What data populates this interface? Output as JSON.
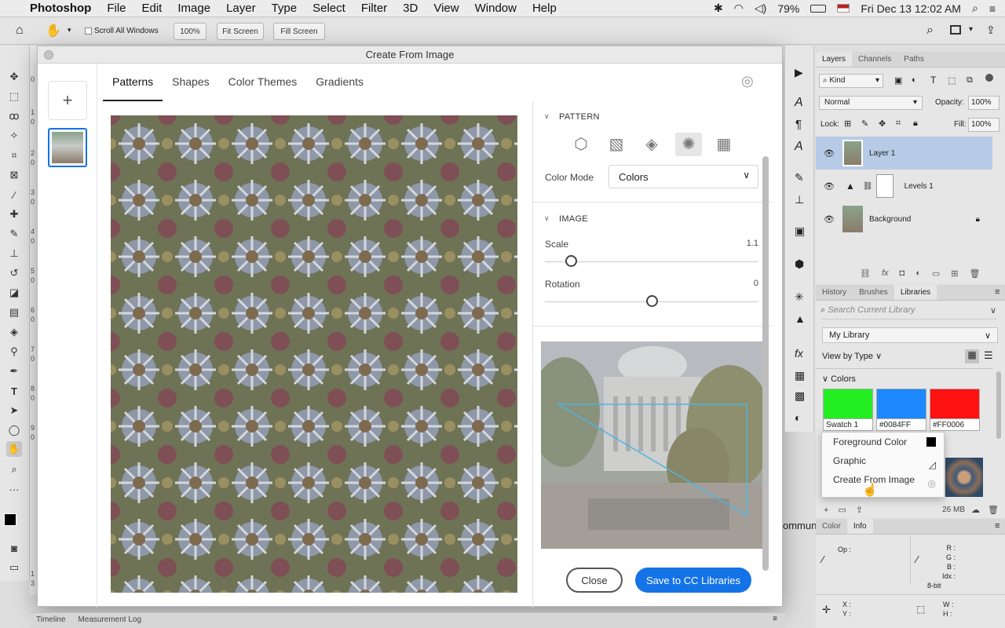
{
  "menubar": {
    "app": "Photoshop",
    "items": [
      "File",
      "Edit",
      "Image",
      "Layer",
      "Type",
      "Select",
      "Filter",
      "3D",
      "View",
      "Window",
      "Help"
    ],
    "battery": "79%",
    "datetime": "Fri Dec 13  12:02 AM"
  },
  "options": {
    "scroll_all": "Scroll All Windows",
    "zoom": "100%",
    "fit_screen": "Fit Screen",
    "fill_screen": "Fill Screen"
  },
  "ruler_labels": [
    "0",
    "1",
    "0",
    "2",
    "0",
    "3",
    "0",
    "4",
    "0",
    "5",
    "0",
    "6",
    "0",
    "7",
    "0",
    "8",
    "0",
    "9",
    "0",
    "1",
    "3"
  ],
  "dialog": {
    "title": "Create From Image",
    "add_glyph": "+",
    "tabs": [
      "Patterns",
      "Shapes",
      "Color Themes",
      "Gradients"
    ],
    "pattern_section": "PATTERN",
    "color_mode_label": "Color Mode",
    "color_mode_value": "Colors",
    "image_section": "IMAGE",
    "scale_label": "Scale",
    "scale_value": "1.1",
    "scale_level": 0.12,
    "rotation_label": "Rotation",
    "rotation_value": "0",
    "rotation_level": 0.5,
    "close_button": "Close",
    "save_button": "Save to CC Libraries",
    "colors": {
      "accent": "#1473e6"
    }
  },
  "layers_panel": {
    "tabs": [
      "Layers",
      "Channels",
      "Paths"
    ],
    "kind": "Kind",
    "blend": "Normal",
    "opacity_label": "Opacity:",
    "opacity": "100%",
    "lock_label": "Lock:",
    "fill_label": "Fill:",
    "fill": "100%",
    "layers": [
      "Layer 1",
      "Levels 1",
      "Background"
    ]
  },
  "libraries_panel": {
    "tabs": [
      "History",
      "Brushes",
      "Libraries"
    ],
    "search_placeholder": "Search Current Library",
    "library": "My Library",
    "view_by": "View by Type",
    "colors_header": "Colors",
    "swatches": [
      {
        "label": "Swatch 1",
        "color": "#22ee22"
      },
      {
        "label": "#0084FF",
        "color": "#1e88ff"
      },
      {
        "label": "#FF0006",
        "color": "#ff1212"
      }
    ],
    "size": "26 MB"
  },
  "context_menu": {
    "items": [
      "Foreground Color",
      "Graphic",
      "Create From Image"
    ]
  },
  "info_panel": {
    "tabs": [
      "Color",
      "Info"
    ],
    "op_label": "Op :",
    "r": "R :",
    "g": "G :",
    "b": "B :",
    "idx": "Idx :",
    "bit": "8-bit",
    "x": "X :",
    "y": "Y :",
    "w": "W :",
    "h": "H :"
  },
  "background_text": "ommun",
  "bottom_tabs": [
    "Timeline",
    "Measurement Log"
  ]
}
